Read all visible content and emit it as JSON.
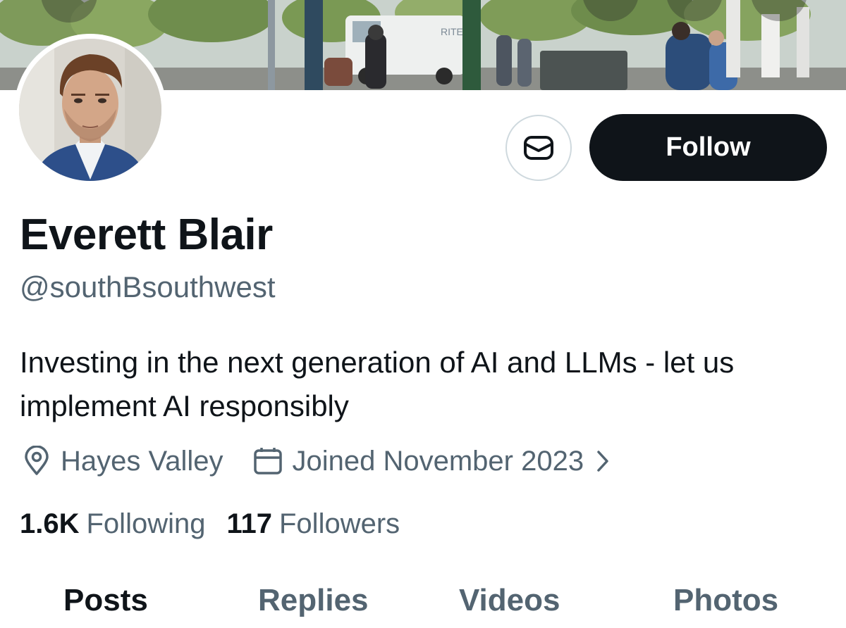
{
  "profile": {
    "display_name": "Everett Blair",
    "handle": "@southBsouthwest",
    "bio": "Investing in the next generation of AI and LLMs - let us implement AI responsibly",
    "location": "Hayes Valley",
    "joined": "Joined November 2023"
  },
  "stats": {
    "following_count": "1.6K",
    "following_label": "Following",
    "followers_count": "117",
    "followers_label": "Followers"
  },
  "actions": {
    "follow_label": "Follow",
    "message_icon": "envelope-icon"
  },
  "tabs": [
    {
      "label": "Posts",
      "active": true
    },
    {
      "label": "Replies",
      "active": false
    },
    {
      "label": "Videos",
      "active": false
    },
    {
      "label": "Photos",
      "active": false
    }
  ],
  "banner": {
    "sign_text": "RITE"
  },
  "colors": {
    "text_primary": "#0f1419",
    "text_secondary": "#536471",
    "follow_button_bg": "#0f1419",
    "follow_button_text": "#ffffff",
    "border": "#cfd9de"
  }
}
